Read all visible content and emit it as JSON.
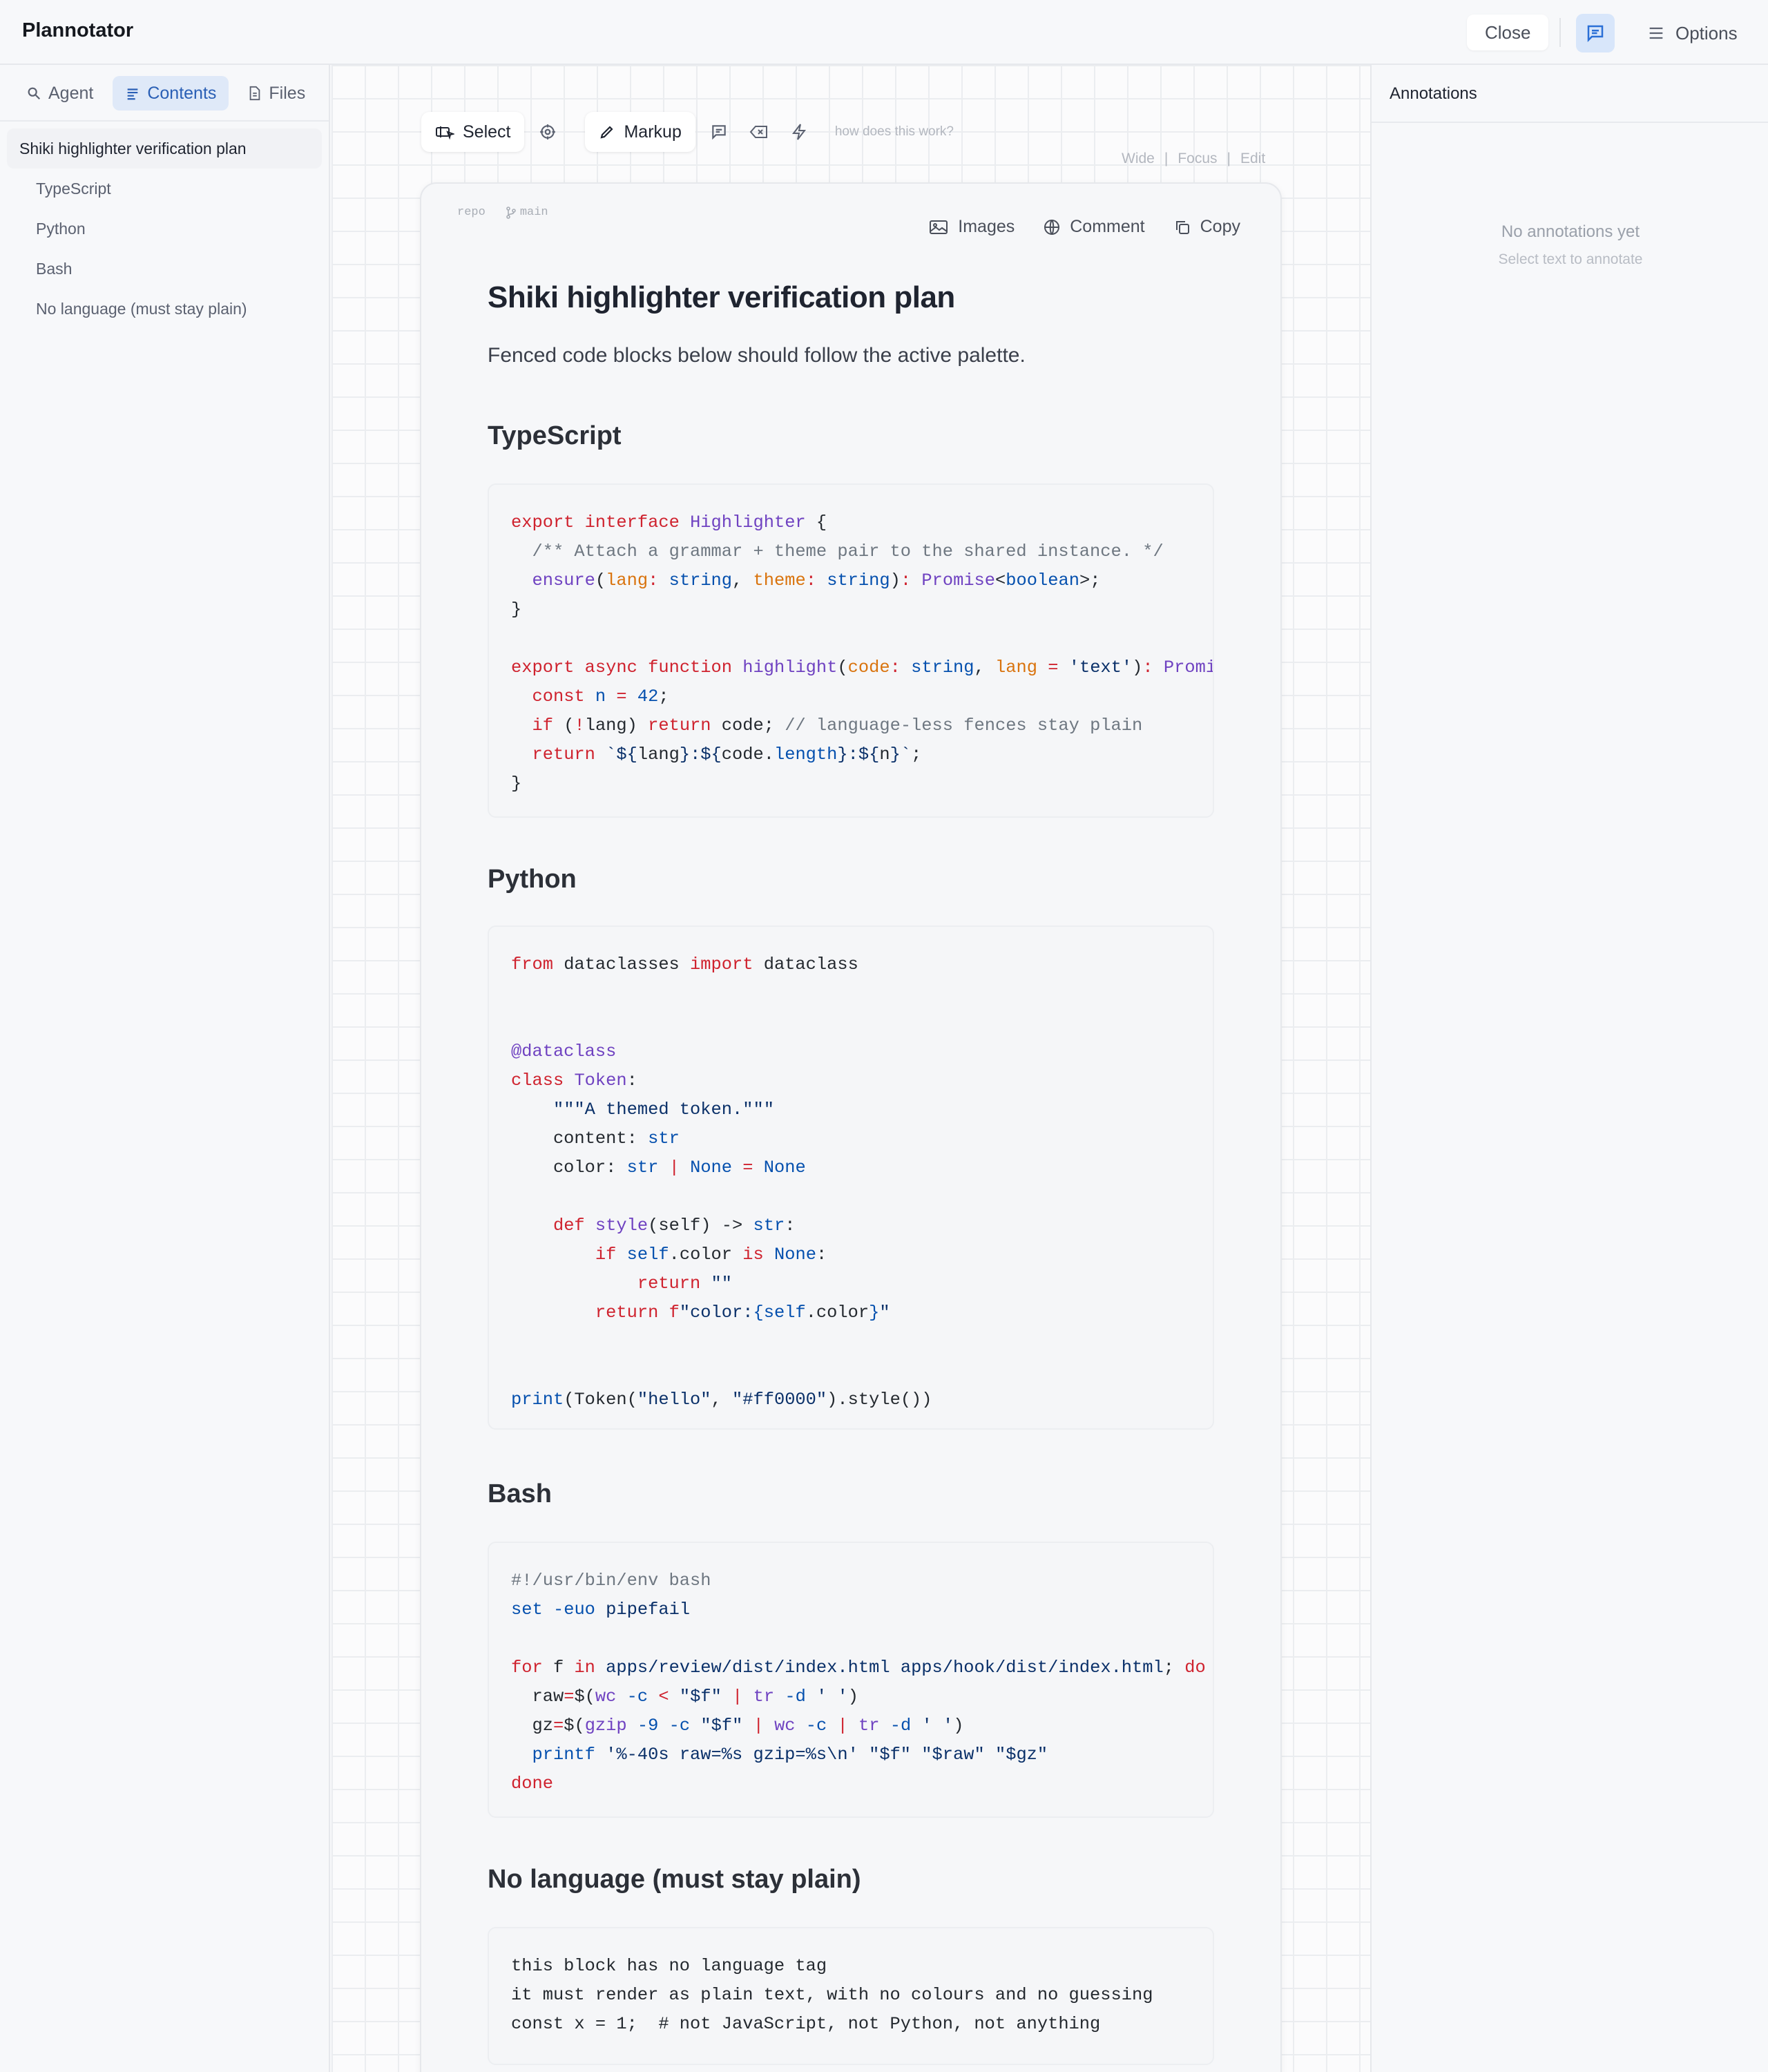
{
  "app": {
    "title": "Plannotator"
  },
  "header": {
    "close_label": "Close",
    "options_label": "Options"
  },
  "sidebar": {
    "tabs": [
      {
        "label": "Agent",
        "icon": "search-icon"
      },
      {
        "label": "Contents",
        "icon": "list-icon",
        "active": true
      },
      {
        "label": "Files",
        "icon": "file-icon"
      }
    ],
    "toc": [
      "Shiki highlighter verification plan",
      "TypeScript",
      "Python",
      "Bash",
      "No language (must stay plain)"
    ]
  },
  "toolbar": {
    "select_label": "Select",
    "markup_label": "Markup",
    "help_text": "how does this work?"
  },
  "view_links": [
    "Wide",
    "Focus",
    "Edit"
  ],
  "doc": {
    "meta_repo": "repo",
    "meta_branch": "main",
    "actions": {
      "images": "Images",
      "comment": "Comment",
      "copy": "Copy"
    },
    "title": "Shiki highlighter verification plan",
    "lead": "Fenced code blocks below should follow the active palette.",
    "sections": [
      "TypeScript",
      "Python",
      "Bash",
      "No language (must stay plain)"
    ]
  },
  "annotations": {
    "title": "Annotations",
    "empty_title": "No annotations yet",
    "empty_hint": "Select text to annotate"
  },
  "colors": {
    "keyword": "#cf222e",
    "type": "#6f42c1",
    "comment": "#6e7781",
    "param": "#d9730d",
    "builtin": "#0550ae",
    "accent": "#2a5fb5"
  }
}
